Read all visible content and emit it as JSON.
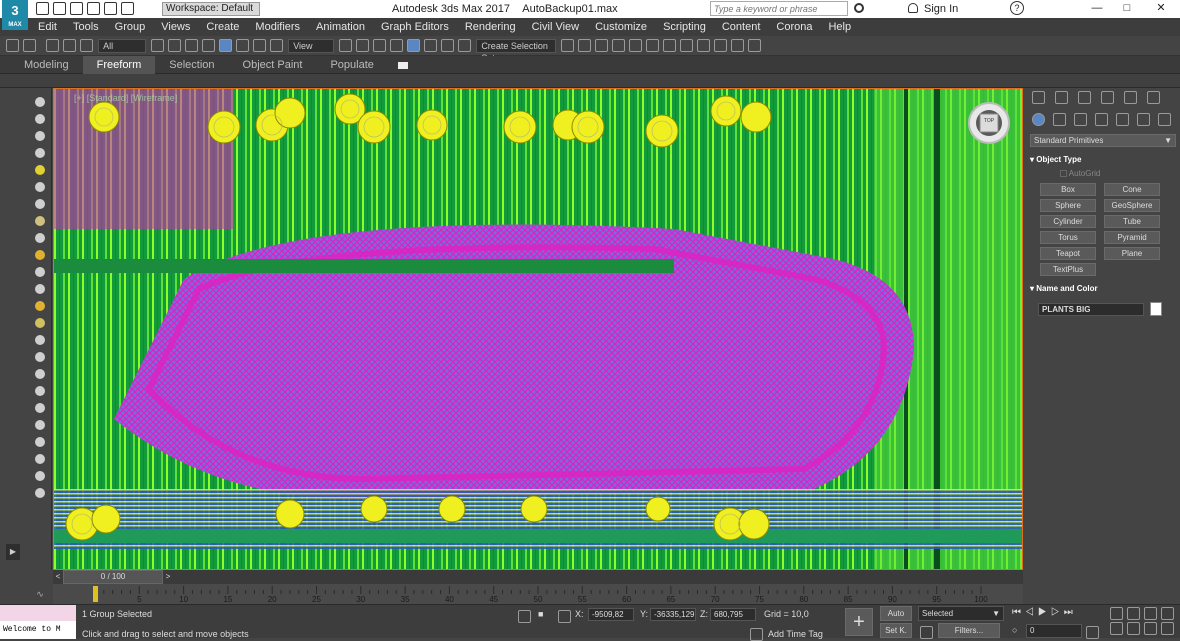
{
  "app": {
    "title": "Autodesk 3ds Max 2017",
    "file": "AutoBackup01.max",
    "workspace": "Workspace: Default",
    "search_placeholder": "Type a keyword or phrase",
    "sign_in": "Sign In",
    "logo_text": "MAX"
  },
  "menu": [
    "Edit",
    "Tools",
    "Group",
    "Views",
    "Create",
    "Modifiers",
    "Animation",
    "Graph Editors",
    "Rendering",
    "Civil View",
    "Customize",
    "Scripting",
    "Content",
    "Corona",
    "Help"
  ],
  "toolbar": {
    "filter": "All",
    "ref_coord": "View",
    "selection_set": "Create Selection Set"
  },
  "ribbon": {
    "tabs": [
      "Modeling",
      "Freeform",
      "Selection",
      "Object Paint",
      "Populate"
    ],
    "active": "Freeform"
  },
  "viewport": {
    "label": "[+] [Standard] [Wireframe]",
    "viewcube": "TOP"
  },
  "command_panel": {
    "category": "Standard Primitives",
    "object_type_title": "Object Type",
    "autogrid": "AutoGrid",
    "buttons": [
      "Box",
      "Cone",
      "Sphere",
      "GeoSphere",
      "Cylinder",
      "Tube",
      "Torus",
      "Pyramid",
      "Teapot",
      "Plane",
      "TextPlus"
    ],
    "name_color_title": "Name and Color",
    "object_name": "PLANTS BIG",
    "object_color": "#ffffff"
  },
  "time": {
    "frame": "0 / 100",
    "ticks": [
      "5",
      "10",
      "15",
      "20",
      "25",
      "30",
      "35",
      "40",
      "45",
      "50",
      "55",
      "60",
      "65",
      "70",
      "75",
      "80",
      "85",
      "90",
      "95",
      "100"
    ]
  },
  "status": {
    "selection": "1 Group Selected",
    "prompt": "Click and drag to select and move objects",
    "x": "-9509,82",
    "y": "-36335,129",
    "z": "680,795",
    "grid": "Grid = 10,0",
    "add_time_tag": "Add Time Tag",
    "auto": "Auto",
    "selected": "Selected",
    "set_key": "Set K.",
    "filters": "Filters...",
    "frame_field": "0",
    "maxscript": "Welcome to M"
  },
  "colors": {
    "accent": "#e07020",
    "viewport_bg": "#0b8a32",
    "wire_magenta": "#e020c0",
    "wire_blue": "#5a8ae0",
    "wire_yellow": "#f0f020",
    "wire_lime": "#7cff30"
  }
}
